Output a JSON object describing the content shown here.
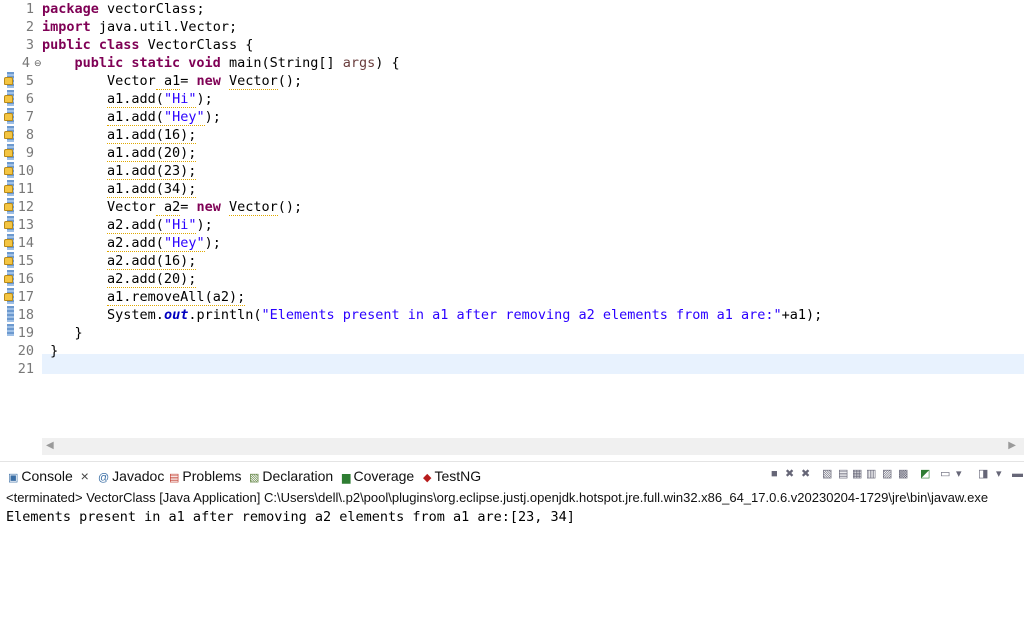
{
  "editor": {
    "line_numbers": [
      "1",
      "2",
      "3",
      "4",
      "5",
      "6",
      "7",
      "8",
      "9",
      "10",
      "11",
      "12",
      "13",
      "14",
      "15",
      "16",
      "17",
      "18",
      "19",
      "20",
      "21"
    ],
    "fold_glyph": "⊖",
    "lines": {
      "l1": {
        "kw": "package",
        "rest": " vectorClass;"
      },
      "l2": {
        "kw": "import",
        "rest": " java.util.Vector;"
      },
      "l3": {
        "kw": "public class",
        "rest": " VectorClass {"
      },
      "l4": {
        "indent": "    ",
        "kw": "public static void",
        "rest": " main(String[] ",
        "param": "args",
        "tail": ") {"
      },
      "l5": {
        "indent": "        ",
        "a": "Vector",
        "b": " a1",
        "c": "= ",
        "kw": "new",
        "d": " ",
        "e": "Vector",
        "f": "();"
      },
      "l6": {
        "indent": "        ",
        "v": "a1.add(",
        "s": "\"Hi\"",
        "t": ");"
      },
      "l7": {
        "indent": "        ",
        "v": "a1.add(",
        "s": "\"Hey\"",
        "t": ");"
      },
      "l8": {
        "indent": "        ",
        "v": "a1.add(16);"
      },
      "l9": {
        "indent": "        ",
        "v": "a1.add(20);"
      },
      "l10": {
        "indent": "        ",
        "v": "a1.add(23);"
      },
      "l11": {
        "indent": "        ",
        "v": "a1.add(34);"
      },
      "l12": {
        "indent": "        ",
        "a": "Vector",
        "b": " a2",
        "c": "= ",
        "kw": "new",
        "d": " ",
        "e": "Vector",
        "f": "();"
      },
      "l13": {
        "indent": "        ",
        "v": "a2.add(",
        "s": "\"Hi\"",
        "t": ");"
      },
      "l14": {
        "indent": "        ",
        "v": "a2.add(",
        "s": "\"Hey\"",
        "t": ");"
      },
      "l15": {
        "indent": "        ",
        "v": "a2.add(16);"
      },
      "l16": {
        "indent": "        ",
        "v": "a2.add(20);"
      },
      "l17": {
        "indent": "        ",
        "v": "a1.removeAll(a2);"
      },
      "l18": {
        "indent": "        ",
        "pre": "System.",
        "fld": "out",
        "mid": ".println(",
        "s": "\"Elements present in a1 after removing a2 elements from a1 are:\"",
        "t": "+a1);"
      },
      "l19": {
        "text": "    }"
      },
      "l20": {
        "text": " }"
      }
    },
    "scroll_left_arrow": "◀",
    "scroll_right_arrow": "▶"
  },
  "console": {
    "tabs": [
      {
        "label": "Console",
        "icon": "console-icon",
        "close": "×"
      },
      {
        "label": "Javadoc",
        "icon": "at-icon"
      },
      {
        "label": "Problems",
        "icon": "problems-icon"
      },
      {
        "label": "Declaration",
        "icon": "declaration-icon"
      },
      {
        "label": "Coverage",
        "icon": "coverage-icon"
      },
      {
        "label": "TestNG",
        "icon": "testng-icon"
      }
    ],
    "status_line": "<terminated> VectorClass [Java Application] C:\\Users\\dell\\.p2\\pool\\plugins\\org.eclipse.justj.openjdk.hotspot.jre.full.win32.x86_64_17.0.6.v20230204-1729\\jre\\bin\\javaw.exe",
    "output": "Elements present in a1 after removing a2 elements from a1 are:[23, 34]"
  },
  "colors": {
    "keyword": "#7f0055",
    "string": "#2a00ff",
    "field": "#0000c0",
    "current_line": "#e8f2fe"
  }
}
